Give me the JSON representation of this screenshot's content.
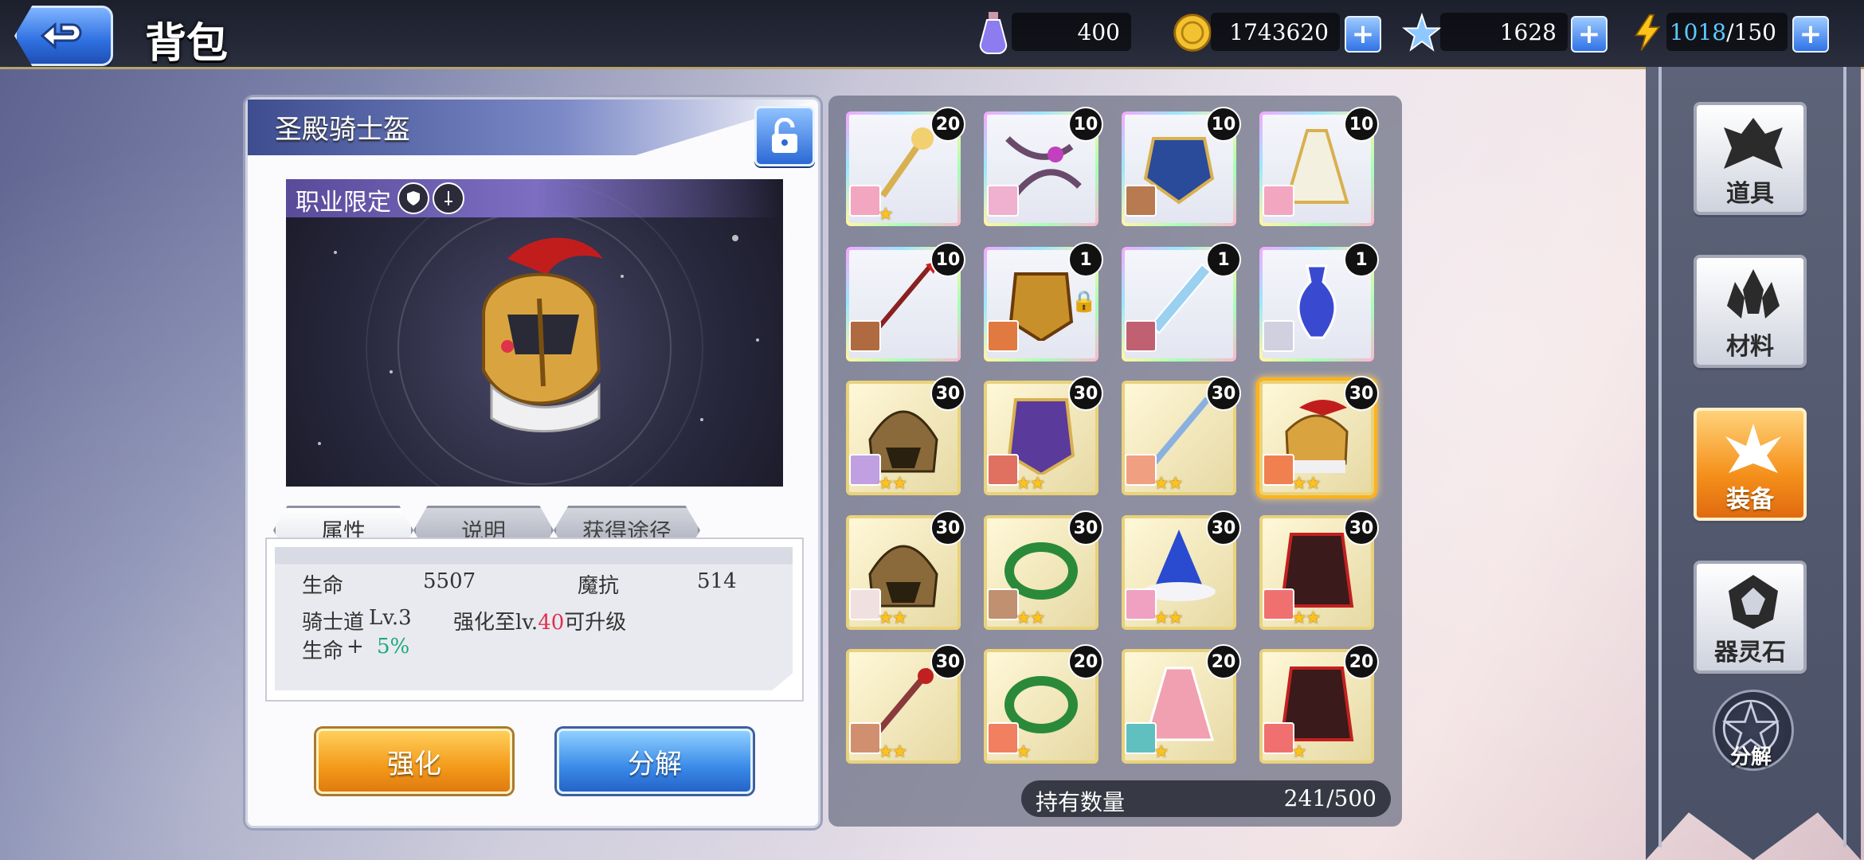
{
  "header": {
    "title": "背包",
    "resources": {
      "potion": {
        "icon": "potion-icon",
        "value": "400"
      },
      "gold": {
        "icon": "gold-coin-icon",
        "value": "1743620"
      },
      "star": {
        "icon": "star-crystal-icon",
        "value": "1628"
      },
      "energy": {
        "icon": "lightning-icon",
        "current": "1018",
        "max": "/150"
      }
    }
  },
  "detail": {
    "item_name": "圣殿骑士盔",
    "class_restriction": "职业限定",
    "tabs": [
      "属性",
      "说明",
      "获得途径"
    ],
    "stats": {
      "hp_label": "生命",
      "hp_value": "5507",
      "mres_label": "魔抗",
      "mres_value": "514",
      "set_name": "骑士道",
      "set_level": "Lv.3",
      "upgrade_pre": "强化至lv.",
      "upgrade_level": "40",
      "upgrade_post": "可升级",
      "bonus_label": "生命",
      "bonus_plus": "+",
      "bonus_value": "5%"
    },
    "buttons": {
      "enhance": "强化",
      "decompose": "分解"
    }
  },
  "inventory": {
    "items": [
      {
        "count": "20",
        "rarity": "rainbow",
        "art": "golden-staff",
        "stars": "★",
        "avatar": "#f3a6c0"
      },
      {
        "count": "10",
        "rarity": "rainbow",
        "art": "chain-flail",
        "stars": "",
        "avatar": "#f0b0d0"
      },
      {
        "count": "10",
        "rarity": "rainbow",
        "art": "blue-armor",
        "stars": "",
        "avatar": "#b87a50"
      },
      {
        "count": "10",
        "rarity": "rainbow",
        "art": "white-robe",
        "stars": "",
        "avatar": "#f3a6c0"
      },
      {
        "count": "10",
        "rarity": "rainbow",
        "art": "red-spear",
        "stars": "",
        "avatar": "#b06a40"
      },
      {
        "count": "1",
        "rarity": "rainbow",
        "art": "gold-armor",
        "stars": "",
        "avatar": "#e07a40",
        "locked": true
      },
      {
        "count": "1",
        "rarity": "rainbow",
        "art": "ice-sword",
        "stars": "",
        "avatar": "#c06070"
      },
      {
        "count": "1",
        "rarity": "rainbow",
        "art": "vase",
        "stars": "",
        "avatar": "#d0d0e0"
      },
      {
        "count": "30",
        "rarity": "gold",
        "art": "lion-helm",
        "stars": "★★",
        "avatar": "#c0a0e0"
      },
      {
        "count": "30",
        "rarity": "gold",
        "art": "purple-armor",
        "stars": "★★",
        "avatar": "#e07060"
      },
      {
        "count": "30",
        "rarity": "gold",
        "art": "blue-sword",
        "stars": "★★",
        "avatar": "#f0a080"
      },
      {
        "count": "30",
        "rarity": "gold",
        "art": "templar-helm",
        "stars": "★★",
        "avatar": "#f08050",
        "selected": true
      },
      {
        "count": "30",
        "rarity": "gold",
        "art": "lion-helm",
        "stars": "★★",
        "avatar": "#f0e0e0"
      },
      {
        "count": "30",
        "rarity": "gold",
        "art": "laurel",
        "stars": "★★",
        "avatar": "#c09070"
      },
      {
        "count": "30",
        "rarity": "gold",
        "art": "wizard-hat",
        "stars": "★★",
        "avatar": "#f0a0c0"
      },
      {
        "count": "30",
        "rarity": "gold",
        "art": "dark-armor",
        "stars": "★★",
        "avatar": "#f07070"
      },
      {
        "count": "30",
        "rarity": "gold",
        "art": "red-staff",
        "stars": "★★",
        "avatar": "#d09070"
      },
      {
        "count": "20",
        "rarity": "gold",
        "art": "laurel",
        "stars": "★",
        "avatar": "#f08060"
      },
      {
        "count": "20",
        "rarity": "gold",
        "art": "pink-dress",
        "stars": "★",
        "avatar": "#60c0c0"
      },
      {
        "count": "20",
        "rarity": "gold",
        "art": "dark-armor",
        "stars": "★",
        "avatar": "#f07070"
      }
    ],
    "count_label": "持有数量",
    "count_value": "241/500"
  },
  "sidebar": {
    "categories": [
      {
        "label": "道具",
        "icon": "items-icon",
        "active": false
      },
      {
        "label": "材料",
        "icon": "crystal-icon",
        "active": false
      },
      {
        "label": "装备",
        "icon": "lily-icon",
        "active": true
      },
      {
        "label": "器灵石",
        "icon": "spirit-stone-icon",
        "active": false
      }
    ],
    "decompose_label": "分解"
  }
}
